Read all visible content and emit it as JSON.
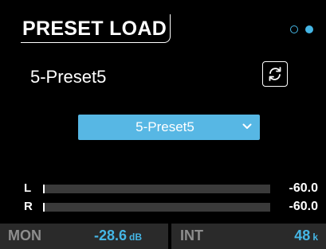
{
  "header": {
    "title": "PRESET LOAD",
    "page_count": 2,
    "active_page": 2
  },
  "preset": {
    "current_name": "5-Preset5",
    "reload_icon": "reload-icon",
    "selected_option": "5-Preset5"
  },
  "meters": [
    {
      "channel": "L",
      "value": "-60.0",
      "level_fraction": 0.0
    },
    {
      "channel": "R",
      "value": "-60.0",
      "level_fraction": 0.0
    }
  ],
  "status": {
    "mon_label": "MON",
    "mon_value": "-28.6",
    "mon_unit": "dB",
    "int_label": "INT",
    "int_value": "48",
    "int_unit": "k"
  },
  "colors": {
    "accent": "#45b6e5",
    "select_bg": "#57b7e4",
    "background": "#000000",
    "status_bg": "#2a2a2a",
    "meter_track": "#3a3a3a",
    "muted_text": "#8e8e8e"
  }
}
